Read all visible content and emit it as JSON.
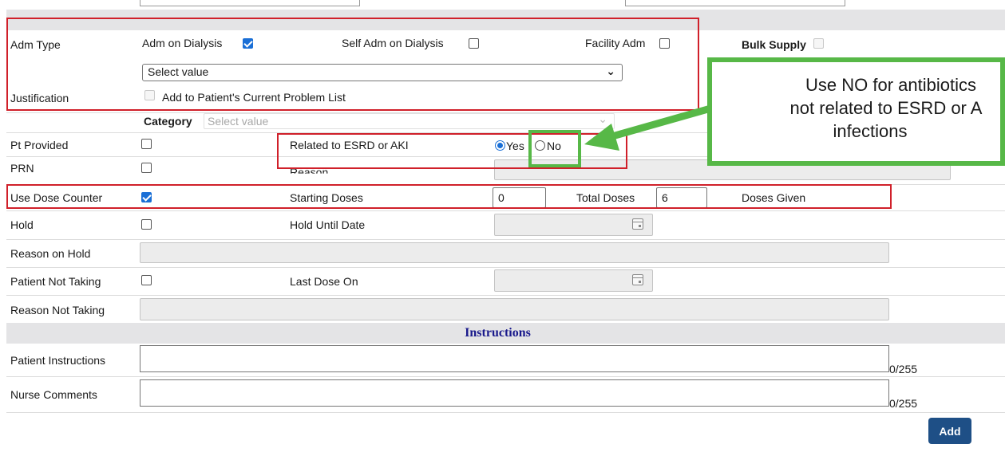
{
  "form": {
    "adm_type": {
      "label": "Adm Type",
      "options": [
        {
          "label": "Adm on Dialysis",
          "checked": true
        },
        {
          "label": "Self Adm on Dialysis",
          "checked": false
        },
        {
          "label": "Facility Adm",
          "checked": false
        }
      ],
      "bulk_supply_label": "Bulk Supply"
    },
    "justification": {
      "label": "Justification",
      "select_value": "Select value",
      "add_to_problem_list_label": "Add to Patient's Current Problem List"
    },
    "category": {
      "label": "Category",
      "placeholder": "Select value"
    },
    "pt_provided": {
      "label": "Pt Provided"
    },
    "related": {
      "label": "Related to ESRD or AKI",
      "yes_label": "Yes",
      "no_label": "No",
      "selected": "Yes"
    },
    "prn": {
      "label": "PRN"
    },
    "reason": {
      "label": "Reason"
    },
    "dose_counter": {
      "label": "Use Dose Counter",
      "starting_label": "Starting Doses",
      "starting_value": "0",
      "total_label": "Total Doses",
      "total_value": "6",
      "given_label": "Doses Given"
    },
    "hold": {
      "label": "Hold",
      "until_label": "Hold Until Date"
    },
    "reason_on_hold": {
      "label": "Reason on Hold"
    },
    "patient_not_taking": {
      "label": "Patient Not Taking",
      "last_dose_label": "Last Dose On"
    },
    "reason_not_taking": {
      "label": "Reason Not Taking"
    },
    "instructions": {
      "header": "Instructions",
      "patient_label": "Patient Instructions",
      "patient_counter": "0/255",
      "nurse_label": "Nurse Comments",
      "nurse_counter": "0/255"
    },
    "add_button": "Add"
  },
  "callout": {
    "line1": "Use NO for antibiotics",
    "line2": "not related to ESRD or A",
    "line3": "infections"
  },
  "colors": {
    "accent": "#1a6fd6",
    "annotation_red": "#d0202a",
    "annotation_green": "#57b847",
    "button": "#1e4f86",
    "header_text": "#1a1a8c"
  }
}
